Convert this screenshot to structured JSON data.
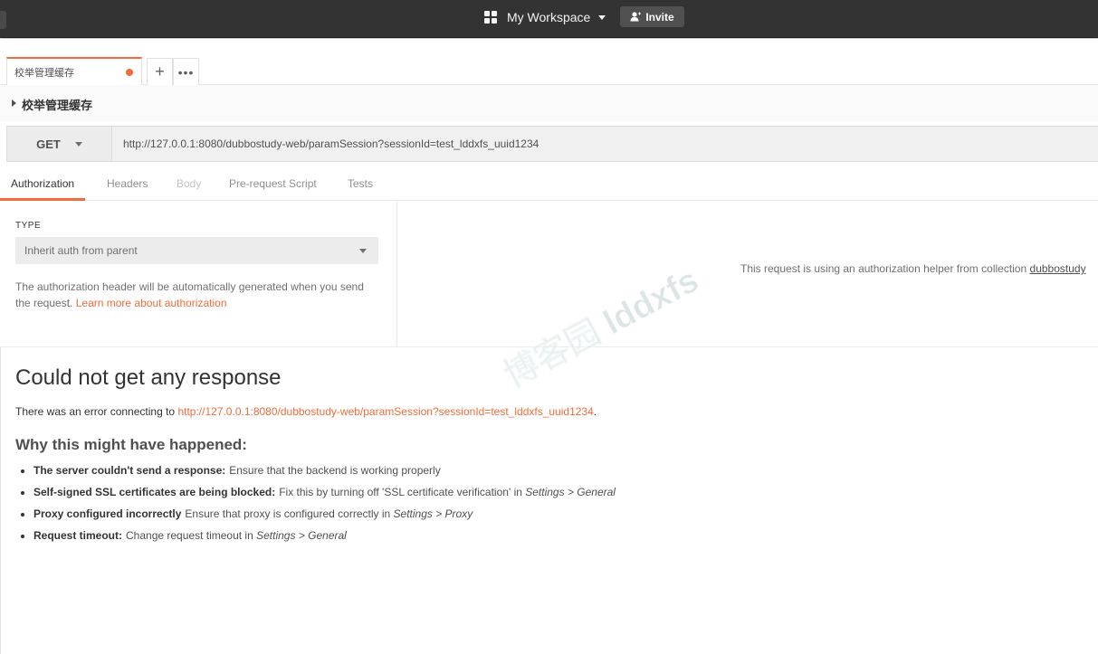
{
  "header": {
    "workspace_label": "My Workspace",
    "invite_label": "Invite"
  },
  "tabs": {
    "active_tab_label": "校举管理缓存",
    "plus_glyph": "+",
    "more_glyph": "•••"
  },
  "request": {
    "name": "校举管理缓存",
    "method": "GET",
    "url": "http://127.0.0.1:8080/dubbostudy-web/paramSession?sessionId=test_lddxfs_uuid1234"
  },
  "subtabs": [
    {
      "label": "Authorization"
    },
    {
      "label": "Headers"
    },
    {
      "label": "Body"
    },
    {
      "label": "Pre-request Script"
    },
    {
      "label": "Tests"
    }
  ],
  "auth": {
    "type_label": "TYPE",
    "type_value": "Inherit auth from parent",
    "description": "The authorization header will be automatically generated when you send the request.",
    "learn_more": "Learn more about authorization",
    "helper_text": "This request is using an authorization helper from collection",
    "collection_name": "dubbostudy"
  },
  "response": {
    "title": "Could not get any response",
    "error_prefix": "There was an error connecting to",
    "error_url": "http://127.0.0.1:8080/dubbostudy-web/paramSession?sessionId=test_lddxfs_uuid1234",
    "error_suffix": ".",
    "why_title": "Why this might have happened:",
    "reasons": [
      {
        "bold": "The server couldn't send a response:",
        "text": "Ensure that the backend is working properly",
        "italic": ""
      },
      {
        "bold": "Self-signed SSL certificates are being blocked:",
        "text": "Fix this by turning off 'SSL certificate verification' in",
        "italic": "Settings > General"
      },
      {
        "bold": "Proxy configured incorrectly",
        "text": "Ensure that proxy is configured correctly in",
        "italic": "Settings > Proxy"
      },
      {
        "bold": "Request timeout:",
        "text": "Change request timeout in",
        "italic": "Settings > General"
      }
    ]
  },
  "watermark": "博客园 lddxfs",
  "colors": {
    "accent": "#f26b3a",
    "topbar": "#333333"
  }
}
